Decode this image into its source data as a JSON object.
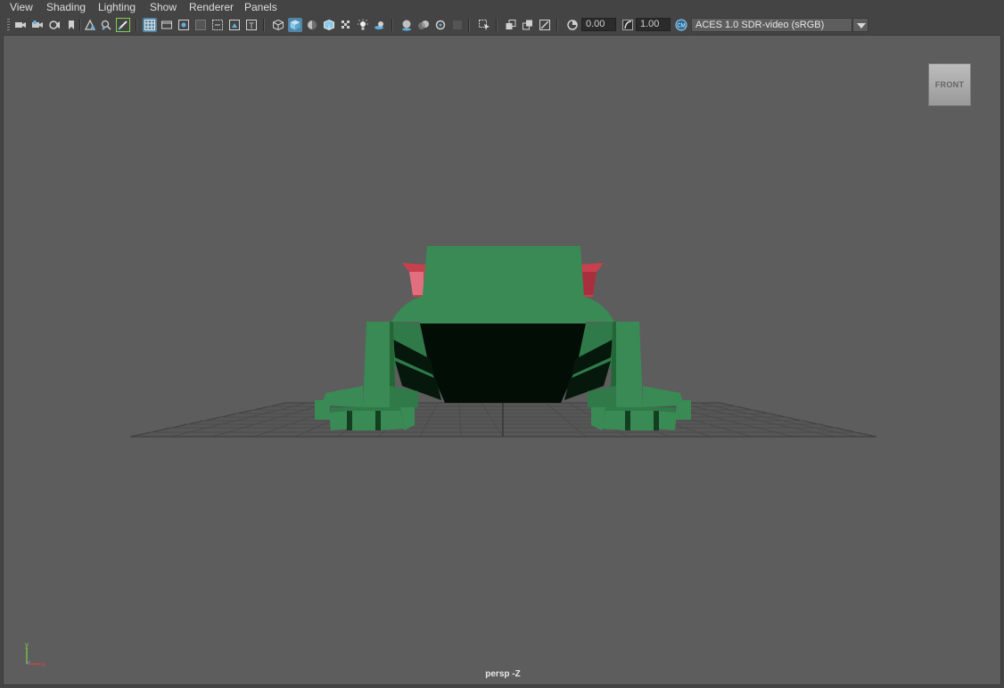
{
  "menu": [
    "View",
    "Shading",
    "Lighting",
    "Show",
    "Renderer",
    "Panels"
  ],
  "toolbar": {
    "exposure_value": "0.00",
    "gamma_value": "1.00",
    "color_space": "ACES 1.0 SDR-video (sRGB)",
    "icons": [
      "select-camera-icon",
      "camera-attributes-icon",
      "bookmarks-icon",
      "bookmark-icon",
      "image-plane-icon",
      "2d-pan-zoom-icon",
      "grease-pencil-icon",
      "grid-icon",
      "film-gate-icon",
      "resolution-gate-icon",
      "gate-mask-icon",
      "field-chart-icon",
      "safe-action-icon",
      "safe-title-icon",
      "wireframe-icon",
      "smooth-shade-all-icon",
      "use-default-material-icon",
      "wireframe-on-shaded-icon",
      "xray-icon",
      "use-all-lights-icon",
      "shadows-icon",
      "screen-space-ao-icon",
      "motion-blur-icon",
      "multisample-aa-icon",
      "depth-of-field-icon",
      "isolate-select-icon",
      "xray-joints-icon",
      "xray-active-components-icon",
      "backface-culling-icon",
      "exposure-icon",
      "gamma-icon",
      "color-management-icon"
    ]
  },
  "viewport": {
    "viewcube_label": "FRONT",
    "camera_label": "persp -Z",
    "axis_y_label": "y",
    "axis_x_label": "x",
    "background_color": "#5d5d5d",
    "model_primary_color": "#3a8a55",
    "model_accent_color": "#c8404e"
  }
}
